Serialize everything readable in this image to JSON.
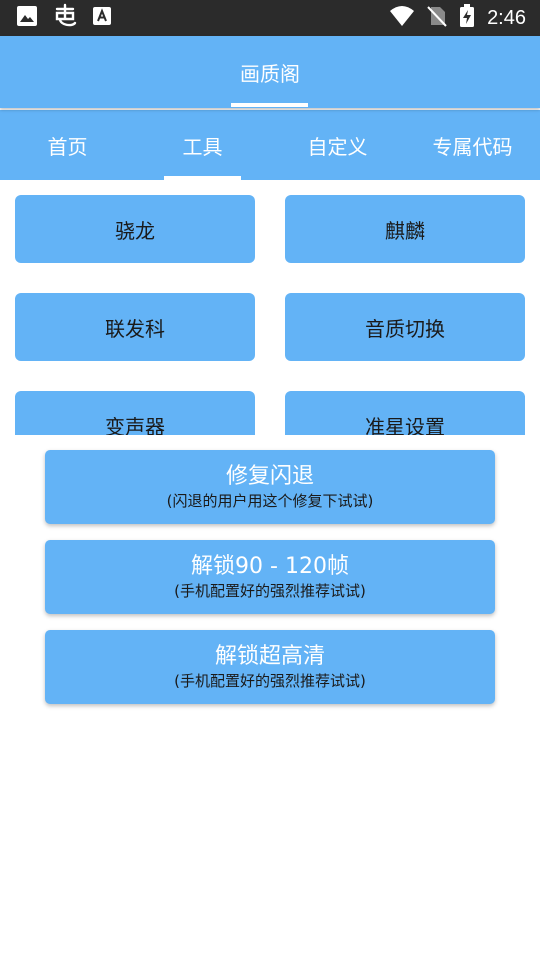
{
  "status_bar": {
    "time": "2:46",
    "left_icons": [
      "image-icon",
      "app-logo-icon",
      "a-box-icon"
    ],
    "right_icons": [
      "wifi-icon",
      "no-sim-icon",
      "battery-charging-icon"
    ]
  },
  "header": {
    "title": "画质阁"
  },
  "tabs": [
    {
      "label": "首页",
      "selected": false
    },
    {
      "label": "工具",
      "selected": true
    },
    {
      "label": "自定义",
      "selected": false
    },
    {
      "label": "专属代码",
      "selected": false
    }
  ],
  "tool_grid": [
    {
      "label": "骁龙"
    },
    {
      "label": "麒麟"
    },
    {
      "label": "联发科"
    },
    {
      "label": "音质切换"
    },
    {
      "label": "变声器"
    },
    {
      "label": "准星设置"
    }
  ],
  "actions": [
    {
      "title": "修复闪退",
      "subtitle": "(闪退的用户用这个修复下试试)"
    },
    {
      "title": "解锁90 - 120帧",
      "subtitle": "(手机配置好的强烈推荐试试)"
    },
    {
      "title": "解锁超高清",
      "subtitle": "(手机配置好的强烈推荐试试)"
    }
  ],
  "colors": {
    "primary": "#63b3f6",
    "status_bar": "#2b2b2b",
    "background": "#ffffff"
  }
}
